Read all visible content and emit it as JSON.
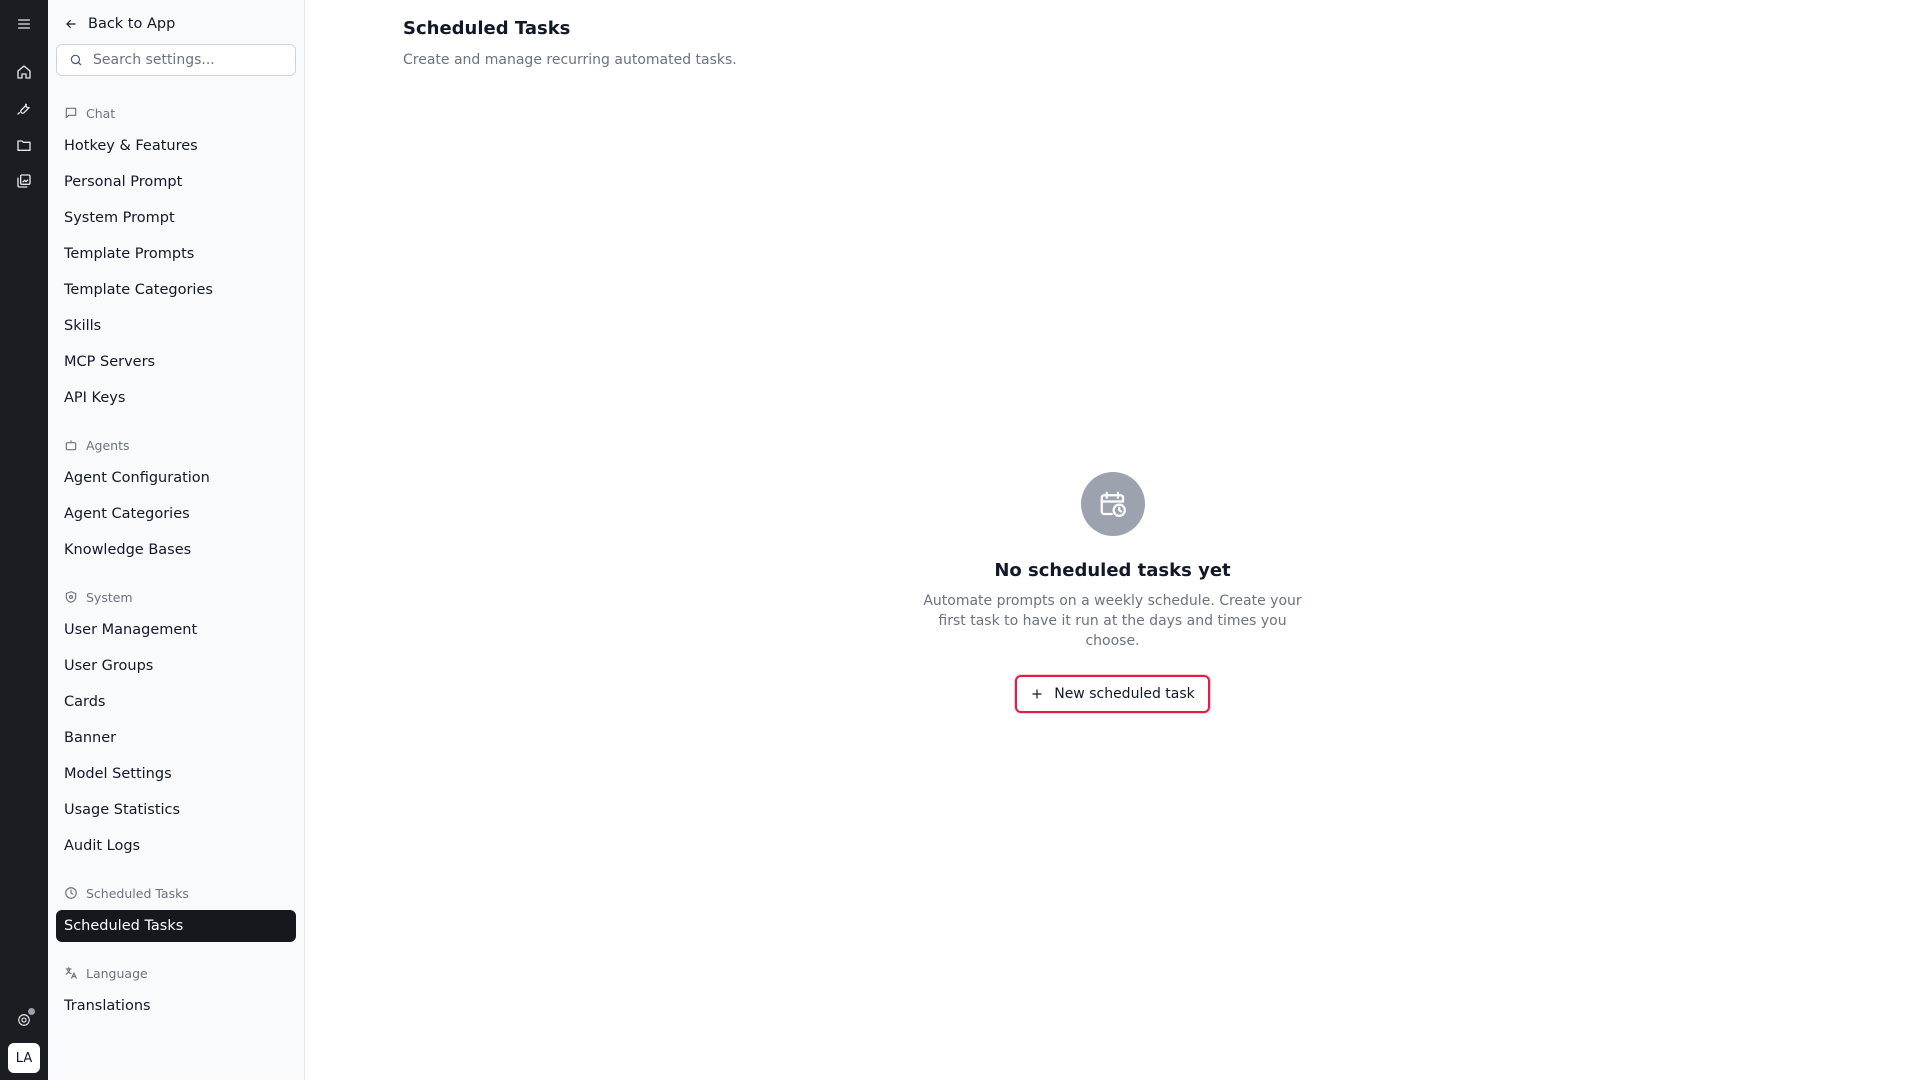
{
  "rail": {
    "user_initials": "LA",
    "icons": [
      "menu-icon",
      "home-icon",
      "wrench-icon",
      "folder-icon",
      "gallery-icon",
      "help-icon"
    ]
  },
  "sidebar": {
    "back_label": "Back to App",
    "search_placeholder": "Search settings...",
    "sections": [
      {
        "title": "Chat",
        "icon": "chat-icon",
        "items": [
          "Hotkey & Features",
          "Personal Prompt",
          "System Prompt",
          "Template Prompts",
          "Template Categories",
          "Skills",
          "MCP Servers",
          "API Keys"
        ]
      },
      {
        "title": "Agents",
        "icon": "robot-icon",
        "items": [
          "Agent Configuration",
          "Agent Categories",
          "Knowledge Bases"
        ]
      },
      {
        "title": "System",
        "icon": "shield-icon",
        "items": [
          "User Management",
          "User Groups",
          "Cards",
          "Banner",
          "Model Settings",
          "Usage Statistics",
          "Audit Logs"
        ]
      },
      {
        "title": "Scheduled Tasks",
        "icon": "clock-icon",
        "items": [
          "Scheduled Tasks"
        ],
        "active": "Scheduled Tasks"
      },
      {
        "title": "Language",
        "icon": "translate-icon",
        "items": [
          "Translations"
        ]
      }
    ]
  },
  "main": {
    "title": "Scheduled Tasks",
    "subtitle": "Create and manage recurring automated tasks.",
    "empty": {
      "title": "No scheduled tasks yet",
      "description": "Automate prompts on a weekly schedule. Create your first task to have it run at the days and times you choose.",
      "button_label": "New scheduled task"
    }
  },
  "colors": {
    "rail_bg": "#1b1d22",
    "active_item_bg": "#16181d",
    "button_border": "#e11d48"
  }
}
